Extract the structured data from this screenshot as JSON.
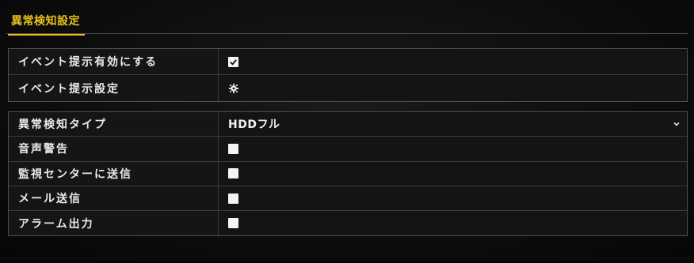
{
  "tab": {
    "label": "異常検知設定"
  },
  "event_group": {
    "rows": [
      {
        "label": "イベント提示有効にする",
        "control": "checkbox",
        "checked": true
      },
      {
        "label": "イベント提示設定",
        "control": "gear"
      }
    ]
  },
  "exception_group": {
    "type_label": "異常検知タイプ",
    "type_value": "HDDフル",
    "rows": [
      {
        "label": "音声警告",
        "checked": false
      },
      {
        "label": "監視センターに送信",
        "checked": false
      },
      {
        "label": "メール送信",
        "checked": false
      },
      {
        "label": "アラーム出力",
        "checked": false
      }
    ]
  },
  "colors": {
    "accent": "#e8c21a",
    "background": "#0d0d0d",
    "border": "#4f4f4f"
  },
  "icons": {
    "checked": "checkmark-icon",
    "settings": "gear-icon",
    "dropdown": "chevron-down-icon"
  }
}
